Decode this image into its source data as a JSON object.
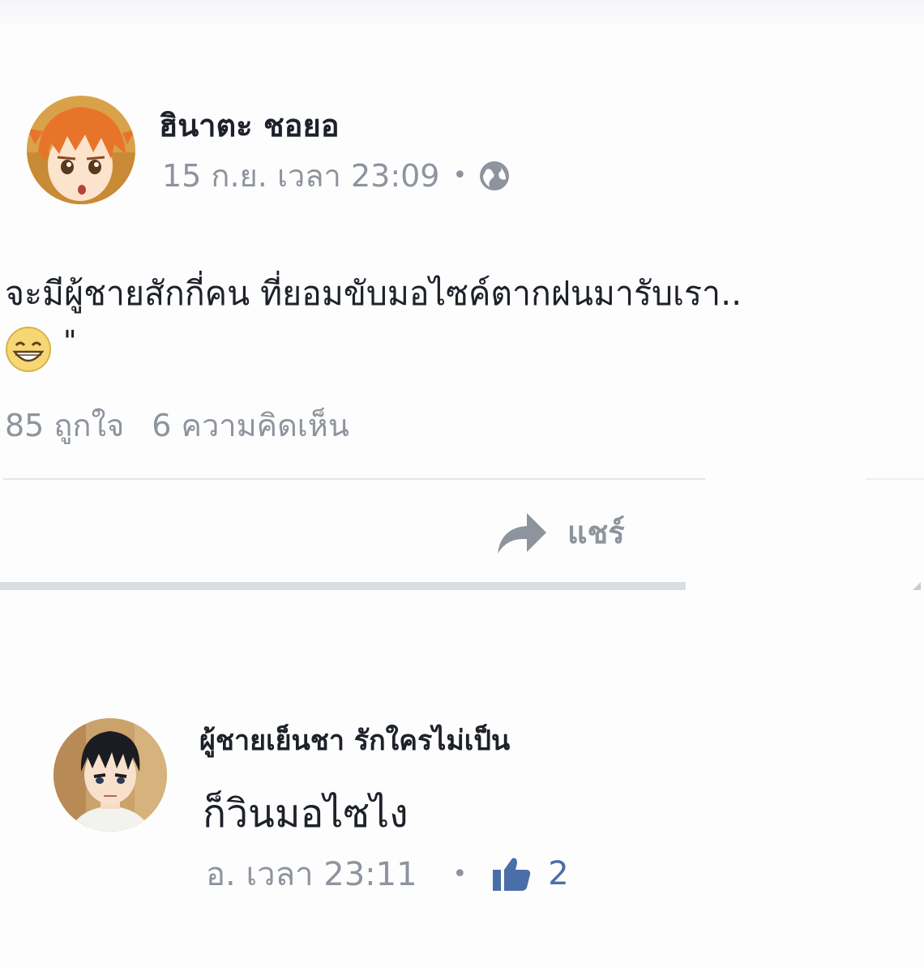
{
  "post": {
    "author_name": "ฮินาตะ ชอยอ",
    "date": "15 ก.ย. เวลา 23:09",
    "dot": "•",
    "privacy_icon": "globe-icon",
    "text_line1": "จะมีผู้ชายสักกี่คน ที่ยอมขับมอไซค์ตากฝนมารับเรา..",
    "text_emoji": "grinning-face-emoji",
    "text_quote": "\"",
    "likes": "85 ถูกใจ",
    "comments": "6 ความคิดเห็น",
    "share_label": "แชร์",
    "share_icon": "share-arrow-icon"
  },
  "comment": {
    "author_name": "ผู้ชายเย็นชา รักใครไม่เป็น",
    "text": "ก็วินมอไซไง",
    "time": "อ. เวลา 23:11",
    "dot": "•",
    "like_icon": "thumbs-up-icon",
    "like_count": "2"
  },
  "colors": {
    "text_primary": "#1d2129",
    "text_secondary": "#8d949e",
    "like_blue": "#4a6ea9",
    "hair_orange": "#e8742a",
    "hair_black": "#1b1b22"
  }
}
